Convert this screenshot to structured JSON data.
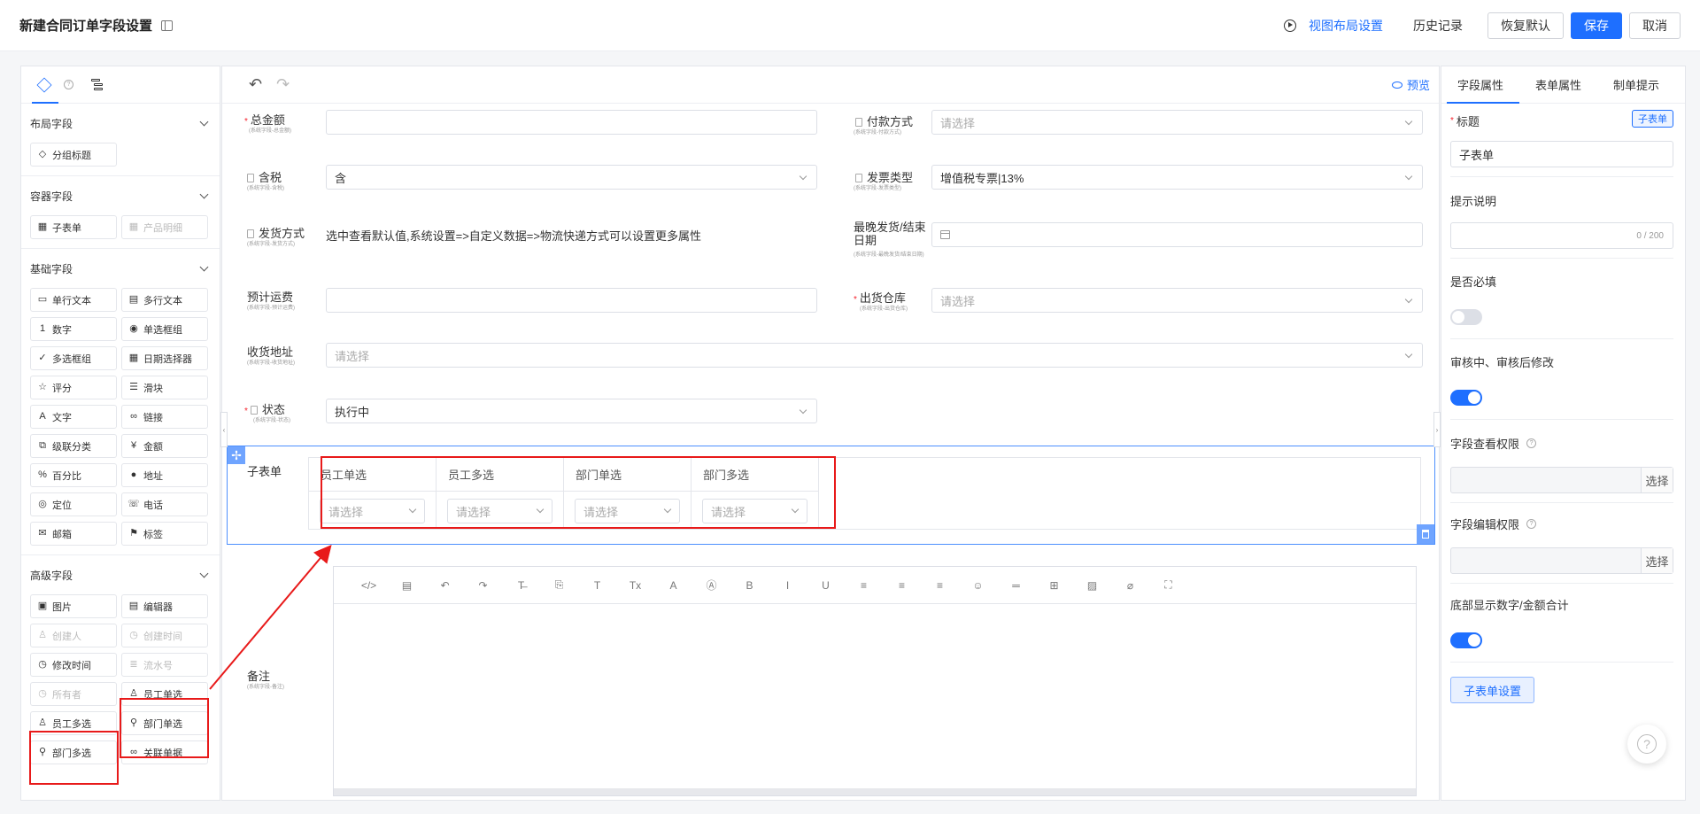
{
  "header": {
    "title": "新建合同订单字段设置",
    "view_layout": "视图布局设置",
    "history": "历史记录",
    "restore": "恢复默认",
    "save": "保存",
    "cancel": "取消"
  },
  "left": {
    "groups": [
      {
        "title": "布局字段",
        "items": [
          {
            "label": "分组标题",
            "icon": "group-icon",
            "disabled": false
          }
        ]
      },
      {
        "title": "容器字段",
        "items": [
          {
            "label": "子表单",
            "icon": "table-icon",
            "disabled": false
          },
          {
            "label": "产品明细",
            "icon": "table-icon",
            "disabled": true
          }
        ]
      },
      {
        "title": "基础字段",
        "items": [
          {
            "label": "单行文本",
            "icon": "single-line-icon",
            "disabled": false
          },
          {
            "label": "多行文本",
            "icon": "multi-line-icon",
            "disabled": false
          },
          {
            "label": "数字",
            "icon": "number-icon",
            "disabled": false
          },
          {
            "label": "单选框组",
            "icon": "radio-icon",
            "disabled": false
          },
          {
            "label": "多选框组",
            "icon": "checkbox-icon",
            "disabled": false
          },
          {
            "label": "日期选择器",
            "icon": "calendar-icon",
            "disabled": false
          },
          {
            "label": "评分",
            "icon": "star-icon",
            "disabled": false
          },
          {
            "label": "滑块",
            "icon": "slider-icon",
            "disabled": false
          },
          {
            "label": "文字",
            "icon": "text-icon",
            "disabled": false
          },
          {
            "label": "链接",
            "icon": "link-icon",
            "disabled": false
          },
          {
            "label": "级联分类",
            "icon": "cascade-icon",
            "disabled": false
          },
          {
            "label": "金额",
            "icon": "money-icon",
            "disabled": false
          },
          {
            "label": "百分比",
            "icon": "percent-icon",
            "disabled": false
          },
          {
            "label": "地址",
            "icon": "location-pin-icon",
            "disabled": false
          },
          {
            "label": "定位",
            "icon": "locate-icon",
            "disabled": false
          },
          {
            "label": "电话",
            "icon": "phone-icon",
            "disabled": false
          },
          {
            "label": "邮箱",
            "icon": "mail-icon",
            "disabled": false
          },
          {
            "label": "标签",
            "icon": "tag-icon",
            "disabled": false
          }
        ]
      },
      {
        "title": "高级字段",
        "items": [
          {
            "label": "图片",
            "icon": "image-icon",
            "disabled": false
          },
          {
            "label": "编辑器",
            "icon": "editor-icon",
            "disabled": false
          },
          {
            "label": "创建人",
            "icon": "user-icon",
            "disabled": true
          },
          {
            "label": "创建时间",
            "icon": "clock-icon",
            "disabled": true
          },
          {
            "label": "修改时间",
            "icon": "clock-icon",
            "disabled": false
          },
          {
            "label": "流水号",
            "icon": "list-icon",
            "disabled": true
          },
          {
            "label": "所有者",
            "icon": "clock-icon",
            "disabled": true
          },
          {
            "label": "员工单选",
            "icon": "user-icon",
            "disabled": false
          },
          {
            "label": "员工多选",
            "icon": "users-icon",
            "disabled": false
          },
          {
            "label": "部门单选",
            "icon": "dept-icon",
            "disabled": false
          },
          {
            "label": "部门多选",
            "icon": "dept-icon",
            "disabled": false
          },
          {
            "label": "关联单据",
            "icon": "link-icon",
            "disabled": false
          }
        ]
      }
    ]
  },
  "canvas": {
    "preview": "预览",
    "fields": {
      "total": {
        "label": "总金额",
        "sub": "(系统字段-总金额)"
      },
      "pay": {
        "label": "付款方式",
        "sub": "(系统字段-付款方式)",
        "placeholder": "请选择"
      },
      "tax": {
        "label": "含税",
        "sub": "(系统字段-含税)",
        "value": "含"
      },
      "invoice": {
        "label": "发票类型",
        "sub": "(系统字段-发票类型)",
        "value": "增值税专票|13%"
      },
      "ship": {
        "label": "发货方式",
        "sub": "(系统字段-发货方式)",
        "text": "选中查看默认值,系统设置=>自定义数据=>物流快递方式可以设置更多属性"
      },
      "latest": {
        "label": "最晚发货/结束日期",
        "sub": "(系统字段-最晚发货/结束日期)"
      },
      "freight": {
        "label": "预计运费",
        "sub": "(系统字段-预计运费)"
      },
      "warehouse": {
        "label": "出货仓库",
        "sub": "(系统字段-出货仓库)",
        "placeholder": "请选择"
      },
      "address": {
        "label": "收货地址",
        "sub": "(系统字段-收货地址)",
        "placeholder": "请选择"
      },
      "status": {
        "label": "状态",
        "sub": "(系统字段-状态)",
        "value": "执行中"
      },
      "subform": {
        "label": "子表单"
      },
      "remark": {
        "label": "备注",
        "sub": "(系统字段-备注)"
      }
    },
    "subtable": {
      "columns": [
        {
          "header": "员工单选",
          "placeholder": "请选择"
        },
        {
          "header": "员工多选",
          "placeholder": "请选择"
        },
        {
          "header": "部门单选",
          "placeholder": "请选择"
        },
        {
          "header": "部门多选",
          "placeholder": "请选择"
        }
      ]
    },
    "editor_tools": [
      "</>",
      "▤",
      "↶",
      "↷",
      "T̶",
      "⎘",
      "T",
      "Tx",
      "A",
      "Ⓐ",
      "B",
      "I",
      "U",
      "≡",
      "≡",
      "≡",
      "☺",
      "═",
      "⊞",
      "▨",
      "⌀",
      "⛶"
    ]
  },
  "right": {
    "tabs": [
      "字段属性",
      "表单属性",
      "制单提示"
    ],
    "title_label": "标题",
    "title_tag": "子表单",
    "title_value": "子表单",
    "hint_label": "提示说明",
    "hint_counter": "0 / 200",
    "required_label": "是否必填",
    "audit_label": "审核中、审核后修改",
    "view_perm_label": "字段查看权限",
    "edit_perm_label": "字段编辑权限",
    "select_btn": "选择",
    "bottom_sum_label": "底部显示数字/金额合计",
    "subset_btn": "子表单设置"
  },
  "colors": {
    "accent": "#1e6fff",
    "highlight": "#e81a1a"
  }
}
